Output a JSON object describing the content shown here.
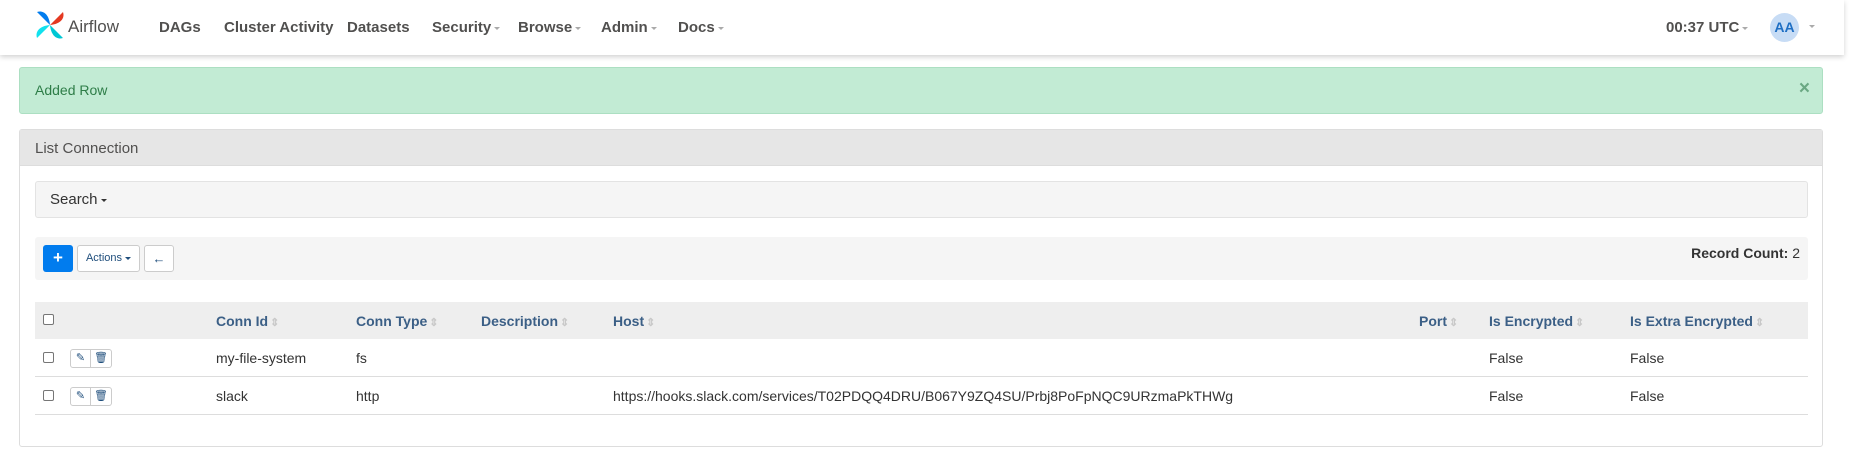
{
  "navbar": {
    "brand": "Airflow",
    "items": [
      {
        "label": "DAGs",
        "dropdown": false
      },
      {
        "label": "Cluster Activity",
        "dropdown": false
      },
      {
        "label": "Datasets",
        "dropdown": false
      },
      {
        "label": "Security",
        "dropdown": true
      },
      {
        "label": "Browse",
        "dropdown": true
      },
      {
        "label": "Admin",
        "dropdown": true
      },
      {
        "label": "Docs",
        "dropdown": true
      }
    ],
    "clock": "00:37 UTC",
    "avatar_initials": "AA"
  },
  "alert": {
    "message": "Added Row",
    "close_symbol": "×"
  },
  "panel": {
    "title": "List Connection",
    "search_label": "Search",
    "add_symbol": "+",
    "actions_label": "Actions",
    "back_symbol": "←",
    "record_count_label": "Record Count:",
    "record_count_value": "2"
  },
  "table": {
    "columns": [
      "Conn Id",
      "Conn Type",
      "Description",
      "Host",
      "Port",
      "Is Encrypted",
      "Is Extra Encrypted"
    ],
    "rows": [
      {
        "conn_id": "my-file-system",
        "conn_type": "fs",
        "description": "",
        "host": "",
        "port": "",
        "is_encrypted": "False",
        "is_extra_encrypted": "False"
      },
      {
        "conn_id": "slack",
        "conn_type": "http",
        "description": "",
        "host": "https://hooks.slack.com/services/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",
        "port": "",
        "is_encrypted": "False",
        "is_extra_encrypted": "False"
      }
    ]
  },
  "colors": {
    "primary": "#017cee",
    "success_bg": "#c2ebd4",
    "header_link": "#3b5f86"
  }
}
